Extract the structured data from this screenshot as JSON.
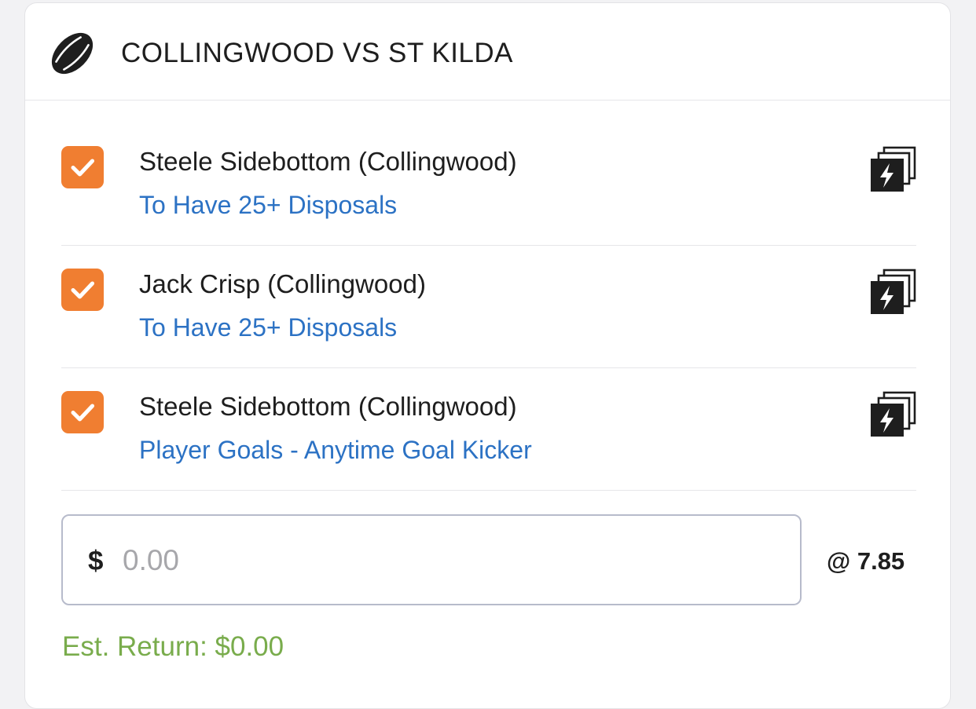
{
  "match": {
    "title": "COLLINGWOOD VS ST KILDA",
    "sport_icon": "australian-football-icon"
  },
  "legs": [
    {
      "selected": true,
      "player": "Steele Sidebottom (Collingwood)",
      "market": "To Have 25+ Disposals",
      "icon": "same-game-multi-icon"
    },
    {
      "selected": true,
      "player": "Jack Crisp (Collingwood)",
      "market": "To Have 25+ Disposals",
      "icon": "same-game-multi-icon"
    },
    {
      "selected": true,
      "player": "Steele Sidebottom (Collingwood)",
      "market": "Player Goals - Anytime Goal Kicker",
      "icon": "same-game-multi-icon"
    }
  ],
  "stake": {
    "currency_symbol": "$",
    "placeholder": "0.00",
    "value": ""
  },
  "odds_label": "@ 7.85",
  "estimated_return": "Est. Return: $0.00",
  "colors": {
    "checkbox": "#f07e31",
    "market_link": "#2c72c4",
    "estimated_return": "#79ac4c",
    "text": "#1e1e1e"
  }
}
